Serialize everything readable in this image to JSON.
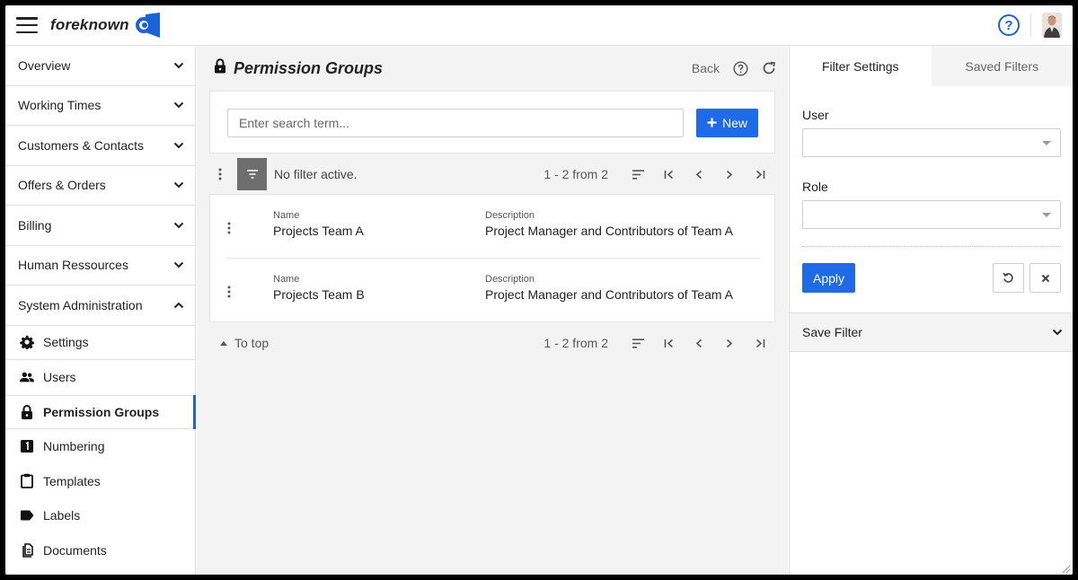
{
  "app": {
    "name": "foreknown",
    "help": "?"
  },
  "sidebar": {
    "sections": [
      {
        "label": "Overview",
        "expanded": false
      },
      {
        "label": "Working Times",
        "expanded": false
      },
      {
        "label": "Customers & Contacts",
        "expanded": false
      },
      {
        "label": "Offers & Orders",
        "expanded": false
      },
      {
        "label": "Billing",
        "expanded": false
      },
      {
        "label": "Human Ressources",
        "expanded": false
      },
      {
        "label": "System Administration",
        "expanded": true
      }
    ],
    "sub_items": [
      {
        "label": "Settings",
        "icon": "gear-icon"
      },
      {
        "label": "Users",
        "icon": "users-icon"
      },
      {
        "label": "Permission Groups",
        "icon": "lock-icon",
        "active": true
      },
      {
        "label": "Numbering",
        "icon": "numbering-icon"
      },
      {
        "label": "Templates",
        "icon": "clipboard-icon"
      },
      {
        "label": "Labels",
        "icon": "label-icon"
      },
      {
        "label": "Documents",
        "icon": "documents-icon"
      }
    ]
  },
  "main": {
    "title": "Permission Groups",
    "back_label": "Back",
    "search": {
      "placeholder": "Enter search term...",
      "value": ""
    },
    "new_label": "New",
    "filter_status": "No filter active.",
    "pager_count": "1 - 2 from 2",
    "columns": {
      "name": "Name",
      "description": "Description"
    },
    "rows": [
      {
        "name": "Projects Team A",
        "description": "Project Manager and Contributors of Team A"
      },
      {
        "name": "Projects Team B",
        "description": "Project Manager and Contributors of Team A"
      }
    ],
    "to_top_label": "To top"
  },
  "filter_panel": {
    "tabs": [
      {
        "label": "Filter Settings",
        "active": true
      },
      {
        "label": "Saved Filters",
        "active": false
      }
    ],
    "user_label": "User",
    "user_value": "",
    "role_label": "Role",
    "role_value": "",
    "apply_label": "Apply",
    "save_filter_label": "Save Filter"
  },
  "colors": {
    "accent": "#1f6ae6",
    "filter_button": "#6e6e6e",
    "main_bg": "#f3f3f3"
  }
}
